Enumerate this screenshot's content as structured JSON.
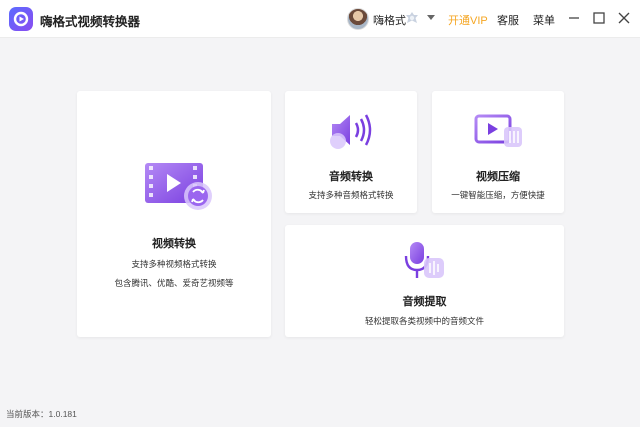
{
  "app": {
    "title": "嗨格式视频转换器",
    "version_label": "当前版本：",
    "version": "1.0.181"
  },
  "header": {
    "username": "嗨格式",
    "open_vip": "开通VIP",
    "service": "客服",
    "menu": "菜单"
  },
  "cards": {
    "video": {
      "title": "视频转换",
      "desc1": "支持多种视频格式转换",
      "desc2": "包含腾讯、优酷、爱奇艺视频等"
    },
    "audio": {
      "title": "音频转换",
      "desc": "支持多种音频格式转换"
    },
    "compress": {
      "title": "视频压缩",
      "desc": "一键智能压缩，方便快捷"
    },
    "extract": {
      "title": "音频提取",
      "desc": "轻松提取各类视频中的音频文件"
    }
  },
  "colors": {
    "accent": "#7a4cf0",
    "vip": "#f5a623",
    "background": "#f4f4f6"
  },
  "icons": [
    "app-logo-icon",
    "vip-badge-icon",
    "video-convert-icon",
    "audio-convert-icon",
    "video-compress-icon",
    "audio-extract-icon"
  ]
}
